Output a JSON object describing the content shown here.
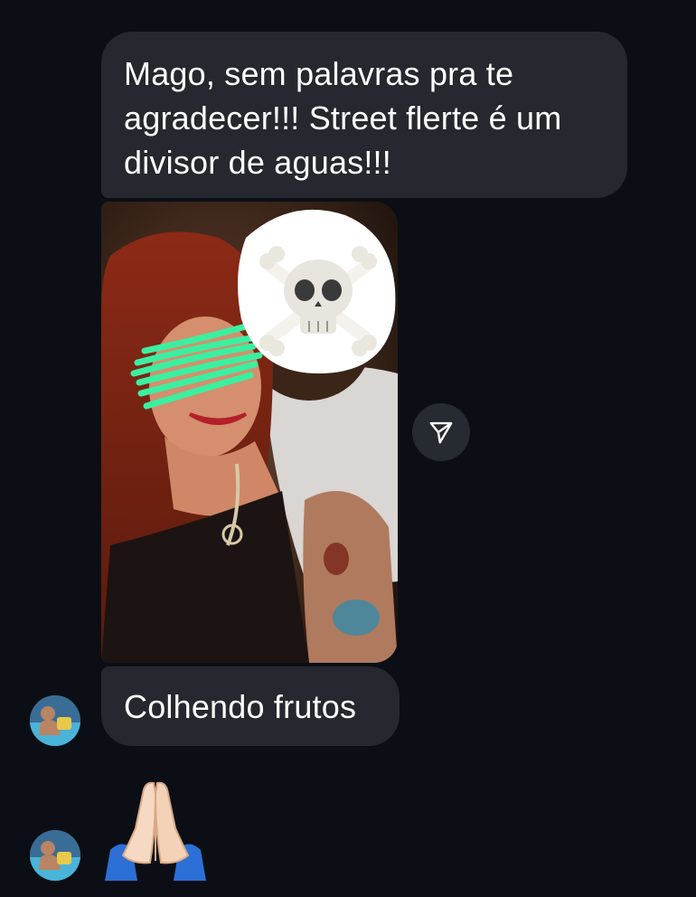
{
  "thread": {
    "messages": [
      {
        "type": "text",
        "text": "Mago, sem palavras pra te agradecer!!! Street flerte é um divisor de aguas!!!"
      },
      {
        "type": "photo",
        "description_icon": "photo-attachment"
      },
      {
        "type": "text",
        "text": "Colhendo frutos"
      },
      {
        "type": "emoji",
        "text": "🙏"
      }
    ],
    "line1": "Mago, sem palavras pra te",
    "line2": "agradecer!!! Street flerte é um",
    "line3": "divisor de aguas!!!",
    "reply": "Colhendo frutos"
  },
  "icons": {
    "share": "send-icon",
    "avatar": "user-avatar"
  },
  "colors": {
    "background": "#0b0f15",
    "bubble": "#25282e",
    "text": "#ffffff",
    "share_button": "#262a31"
  }
}
